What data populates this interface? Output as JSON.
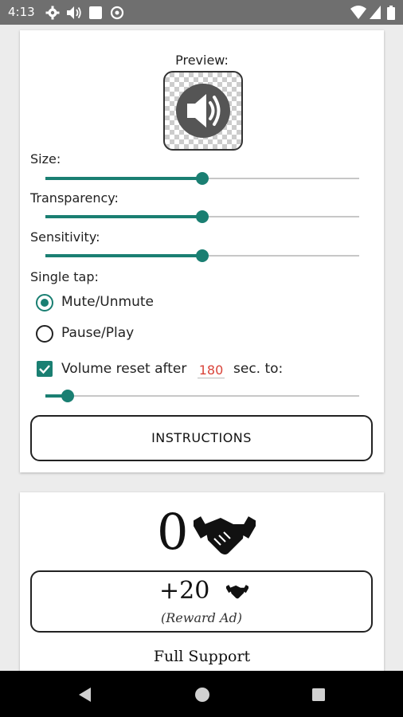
{
  "status_bar": {
    "time": "4:13"
  },
  "settings": {
    "preview_label": "Preview:",
    "size": {
      "label": "Size:",
      "value": 0.5
    },
    "transparency": {
      "label": "Transparency:",
      "value": 0.5
    },
    "sensitivity": {
      "label": "Sensitivity:",
      "value": 0.5
    },
    "single_tap": {
      "label": "Single tap:",
      "options": [
        "Mute/Unmute",
        "Pause/Play"
      ],
      "selected": "Mute/Unmute"
    },
    "volume_reset": {
      "checked": true,
      "label_prefix": "Volume reset after",
      "seconds": "180",
      "label_suffix": "sec. to:",
      "level": 0.07
    },
    "instructions_label": "INSTRUCTIONS"
  },
  "support": {
    "count": "0",
    "reward_amount": "+20",
    "reward_label": "(Reward Ad)",
    "full_support_label": "Full Support"
  },
  "colors": {
    "accent": "#1a7f72",
    "number_field": "#d9443a"
  }
}
